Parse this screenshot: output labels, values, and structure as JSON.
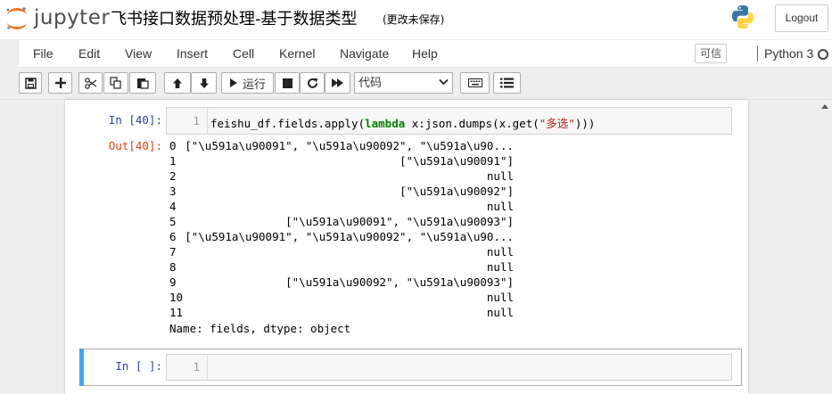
{
  "header": {
    "logo_text": "jupyter",
    "notebook_title": "飞书接口数据预处理-基于数据类型",
    "autosave_status": "(更改未保存)",
    "logout_label": "Logout"
  },
  "menu": {
    "items": [
      "File",
      "Edit",
      "View",
      "Insert",
      "Cell",
      "Kernel",
      "Navigate",
      "Help"
    ],
    "trusted_label": "可信",
    "kernel_name": "Python 3"
  },
  "toolbar": {
    "run_label": "运行",
    "cell_type": "代码"
  },
  "cells": [
    {
      "in_prompt": "In  [40]:",
      "line_number": "1",
      "code_parts": [
        "feishu_df.fields.apply(",
        "lambda",
        " x:json.dumps(x.get(",
        "\"多选\"",
        ")))"
      ],
      "out_prompt": "Out[40]:",
      "output_rows": [
        {
          "index": "0",
          "value": "[\"\\u591a\\u90091\", \"\\u591a\\u90092\", \"\\u591a\\u90..."
        },
        {
          "index": "1",
          "value": "[\"\\u591a\\u90091\"]"
        },
        {
          "index": "2",
          "value": "null"
        },
        {
          "index": "3",
          "value": "[\"\\u591a\\u90092\"]"
        },
        {
          "index": "4",
          "value": "null"
        },
        {
          "index": "5",
          "value": "[\"\\u591a\\u90091\", \"\\u591a\\u90093\"]"
        },
        {
          "index": "6",
          "value": "[\"\\u591a\\u90091\", \"\\u591a\\u90092\", \"\\u591a\\u90..."
        },
        {
          "index": "7",
          "value": "null"
        },
        {
          "index": "8",
          "value": "null"
        },
        {
          "index": "9",
          "value": "[\"\\u591a\\u90092\", \"\\u591a\\u90093\"]"
        },
        {
          "index": "10",
          "value": "null"
        },
        {
          "index": "11",
          "value": "null"
        }
      ],
      "footer": "Name: fields, dtype: object"
    },
    {
      "in_prompt": "In  [ ]:",
      "line_number": "1"
    }
  ],
  "colors": {
    "in_prompt": "#303f9f",
    "out_prompt": "#d84315",
    "keyword": "#008000",
    "string": "#ba2121",
    "selected_cell_bar": "#42a5f5"
  }
}
